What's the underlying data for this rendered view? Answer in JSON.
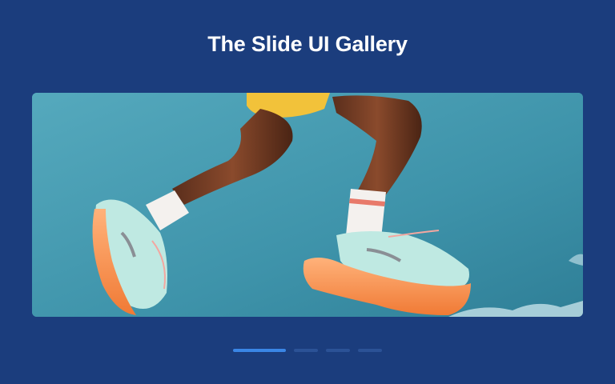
{
  "gallery": {
    "title": "The Slide UI Gallery"
  },
  "slide": {
    "image_icon": "sneakers-photo",
    "current_index": 1,
    "total": 4
  },
  "pagination": {
    "items": [
      {
        "active": true
      },
      {
        "active": false
      },
      {
        "active": false
      },
      {
        "active": false
      }
    ]
  },
  "colors": {
    "background": "#1b3d7d",
    "accent": "#3a86e6",
    "inactive_dot": "#2b5296",
    "sky": "#4aa0b6"
  }
}
